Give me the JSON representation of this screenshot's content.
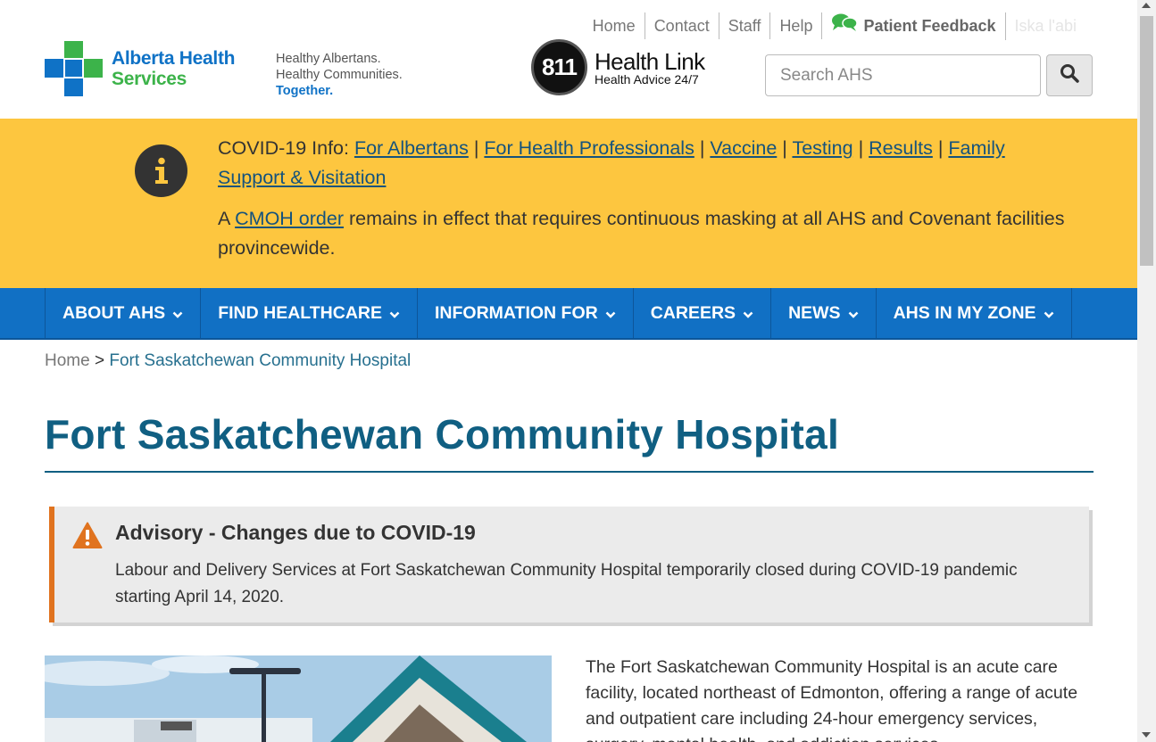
{
  "header": {
    "top_links": [
      "Home",
      "Contact",
      "Staff",
      "Help"
    ],
    "patient_feedback": "Patient Feedback",
    "language_link": "Iska l'abi",
    "logo": {
      "line1": "Alberta Health",
      "line2": "Services"
    },
    "tagline": {
      "line1": "Healthy Albertans.",
      "line2": "Healthy Communities.",
      "line3": "Together."
    },
    "health_link": {
      "number": "811",
      "title": "Health Link",
      "subtitle": "Health Advice 24/7"
    },
    "search": {
      "placeholder": "Search AHS"
    }
  },
  "covid_alert": {
    "lead": "COVID-19 Info:",
    "links": [
      "For Albertans",
      "For Health Professionals",
      "Vaccine",
      "Testing",
      "Results",
      "Family Support & Visitation"
    ],
    "separator": "|",
    "note_prefix": "A",
    "note_link": "CMOH order",
    "note_suffix": "remains in effect that requires continuous masking at all AHS and Covenant facilities provincewide."
  },
  "nav": {
    "items": [
      "ABOUT AHS",
      "FIND HEALTHCARE",
      "INFORMATION FOR",
      "CAREERS",
      "NEWS",
      "AHS IN MY ZONE"
    ]
  },
  "breadcrumb": {
    "home": "Home",
    "separator": ">",
    "current": "Fort Saskatchewan Community Hospital"
  },
  "page_title": "Fort Saskatchewan Community Hospital",
  "advisory": {
    "title": "Advisory - Changes due to COVID-19",
    "text": "Labour and Delivery Services at Fort Saskatchewan Community Hospital temporarily closed during COVID-19 pandemic starting April 14, 2020."
  },
  "intro": "The Fort Saskatchewan Community Hospital is an acute care facility, located northeast of Edmonton, offering a range of acute and outpatient care including 24-hour emergency services, surgery, mental health, and addiction services.",
  "colors": {
    "brand_blue": "#1170c4",
    "brand_green": "#3cb34a",
    "alert_yellow": "#fdc63f",
    "title_teal": "#105f82",
    "advisory_orange": "#e0731f"
  },
  "icons": [
    "chat-bubbles-icon",
    "search-icon",
    "info-icon",
    "chevron-down-icon",
    "warning-icon"
  ]
}
